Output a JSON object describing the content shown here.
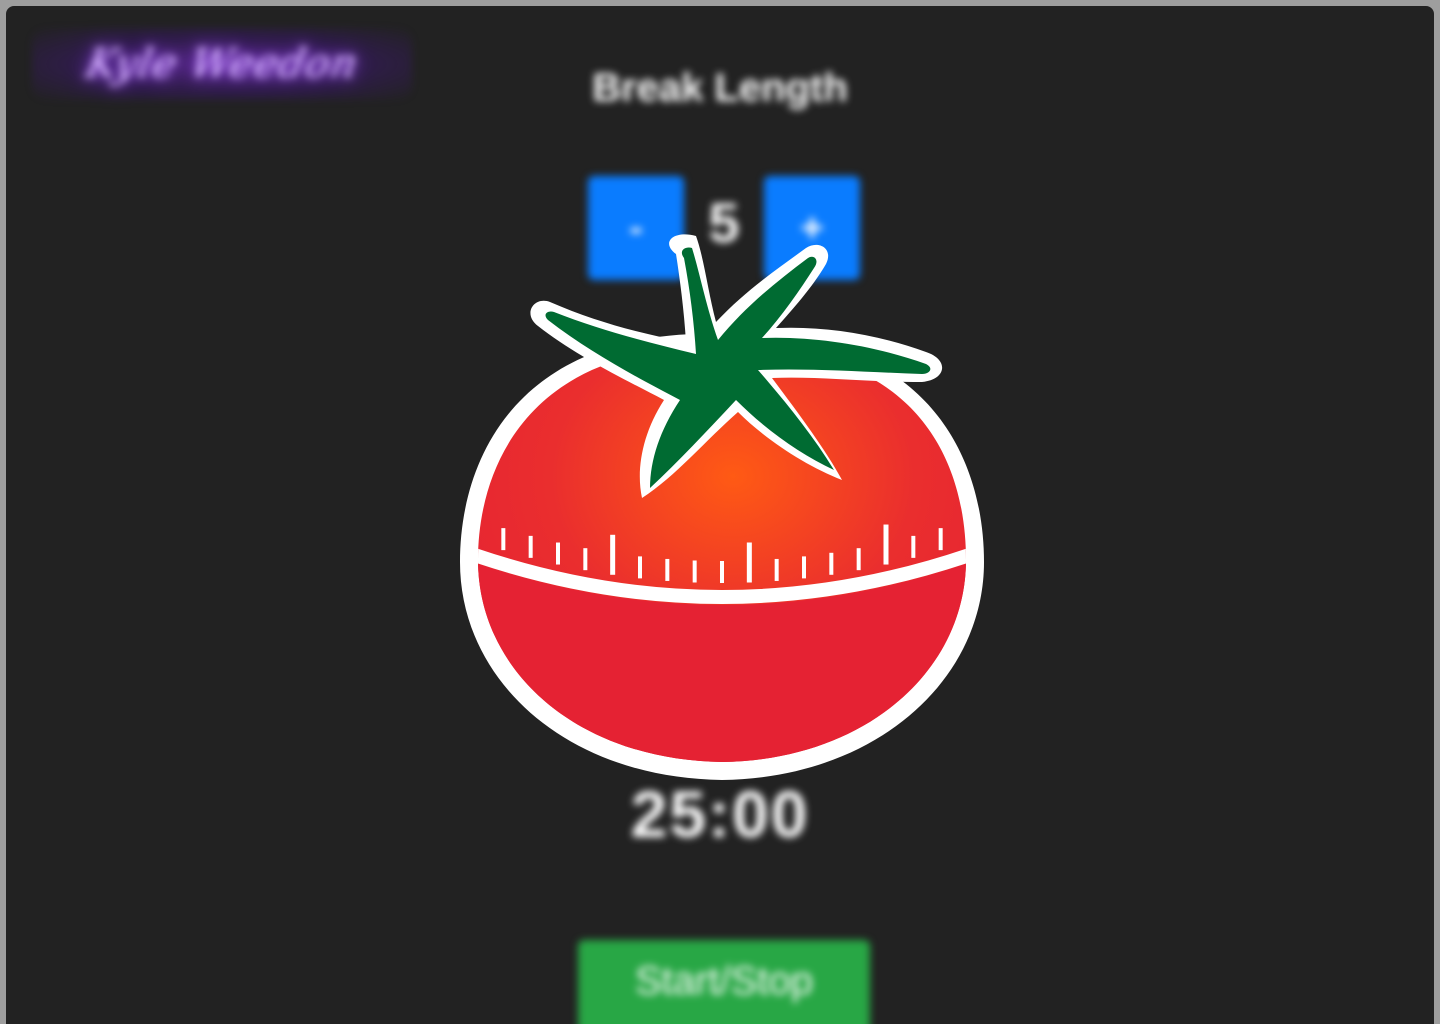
{
  "logo": {
    "text": "Kyle Weedon"
  },
  "break_length": {
    "label": "Break Length",
    "value": "5",
    "decrement_label": "-",
    "increment_label": "+"
  },
  "timer": {
    "display": "25:00"
  },
  "controls": {
    "start_stop_label": "Start/Stop"
  },
  "colors": {
    "background": "#222222",
    "accent_blue": "#0a7cff",
    "accent_green": "#28a745",
    "tomato_red": "#e52233",
    "leaf_green": "#006b32"
  }
}
